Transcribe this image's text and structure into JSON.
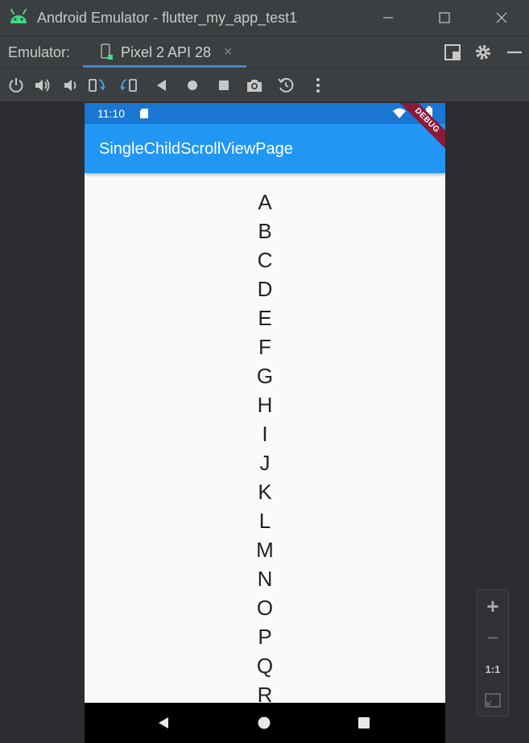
{
  "window": {
    "title": "Android Emulator - flutter_my_app_test1",
    "icons": [
      "android-icon",
      "minimize-icon",
      "maximize-icon",
      "close-icon"
    ]
  },
  "tabbar": {
    "label": "Emulator:",
    "tab": {
      "label": "Pixel 2 API 28",
      "close": "×"
    },
    "right_icons": [
      "layout-icon",
      "settings-icon",
      "hide-icon"
    ]
  },
  "toolbar": {
    "icons": [
      "power-icon",
      "volume-up-icon",
      "volume-down-icon",
      "rotate-left-icon",
      "rotate-right-icon",
      "back-icon",
      "home-icon",
      "overview-icon",
      "screenshot-icon",
      "snapshot-icon",
      "more-icon"
    ]
  },
  "device": {
    "status_time": "11:10",
    "debug_label": "DEBUG",
    "app_title": "SingleChildScrollViewPage",
    "letters": [
      "A",
      "B",
      "C",
      "D",
      "E",
      "F",
      "G",
      "H",
      "I",
      "J",
      "K",
      "L",
      "M",
      "N",
      "O",
      "P",
      "Q",
      "R"
    ],
    "nav_icons": [
      "nav-back-icon",
      "nav-home-icon",
      "nav-recents-icon"
    ]
  },
  "zoom": {
    "plus": "+",
    "minus": "−",
    "one_to_one": "1:1"
  },
  "colors": {
    "status_bar": "#1976d2",
    "app_bar": "#2196f3",
    "accent_underline": "#4a88c7",
    "debug_ribbon": "#8b1a3a"
  }
}
